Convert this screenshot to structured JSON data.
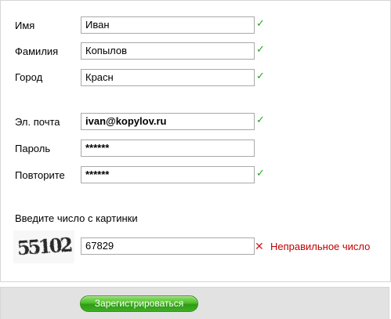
{
  "form": {
    "first_name": {
      "label": "Имя",
      "value": "Иван",
      "status": "✓"
    },
    "last_name": {
      "label": "Фамилия",
      "value": "Копылов",
      "status": "✓"
    },
    "city": {
      "label": "Город",
      "value": "Красн",
      "status": "✓"
    },
    "email": {
      "label": "Эл. почта",
      "value": "ivan@kopylov.ru",
      "status": "✓"
    },
    "password": {
      "label": "Пароль",
      "value": "******"
    },
    "password_repeat": {
      "label": "Повторите",
      "value": "******",
      "status": "✓"
    },
    "captcha": {
      "prompt": "Введите число с картинки",
      "image_text": "55102",
      "value": "67829",
      "status": "✕",
      "error": "Неправильное число"
    }
  },
  "actions": {
    "submit_label": "Зарегистрироваться"
  },
  "colors": {
    "ok": "#22a322",
    "error": "#c00000",
    "button_green": "#3fae22",
    "bar_gray": "#e2e2e2"
  }
}
